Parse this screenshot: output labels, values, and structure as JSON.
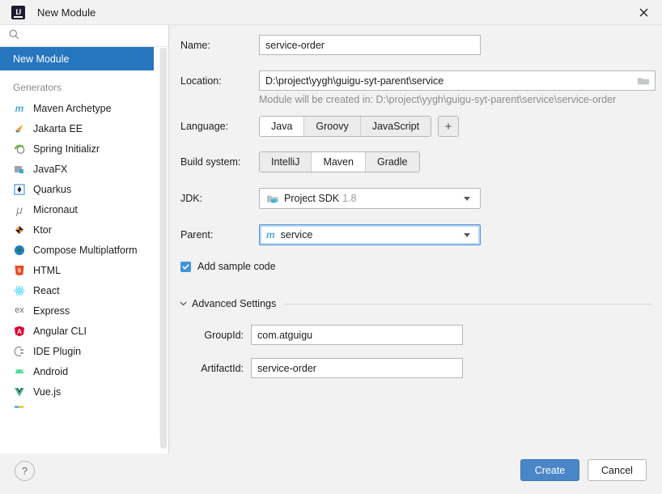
{
  "window": {
    "title": "New Module",
    "app_icon": "intellij-idea-icon",
    "close_icon": "close-icon"
  },
  "sidebar": {
    "search": {
      "value": "",
      "placeholder": "",
      "icon": "search-icon"
    },
    "selected_item": "New Module",
    "generators_label": "Generators",
    "items": [
      {
        "label": "Maven Archetype",
        "icon": "maven-icon",
        "glyph": "m",
        "color": "#4fa6dd"
      },
      {
        "label": "Jakarta EE",
        "icon": "jakarta-ee-icon",
        "glyph": "◢",
        "color": "#f89c2c"
      },
      {
        "label": "Spring Initializr",
        "icon": "spring-icon",
        "glyph": "◉",
        "color": "#6db33f"
      },
      {
        "label": "JavaFX",
        "icon": "javafx-icon",
        "glyph": "◰",
        "color": "#8c9aa5"
      },
      {
        "label": "Quarkus",
        "icon": "quarkus-icon",
        "glyph": "✸",
        "color": "#4695eb"
      },
      {
        "label": "Micronaut",
        "icon": "micronaut-icon",
        "glyph": "μ",
        "color": "#8d8d97"
      },
      {
        "label": "Ktor",
        "icon": "ktor-icon",
        "glyph": "◆",
        "color": "#f2811d"
      },
      {
        "label": "Compose Multiplatform",
        "icon": "compose-icon",
        "glyph": "●",
        "color": "#1f7ec2"
      },
      {
        "label": "HTML",
        "icon": "html5-icon",
        "glyph": "5",
        "color": "#e44d26"
      },
      {
        "label": "React",
        "icon": "react-icon",
        "glyph": "⚛",
        "color": "#61dafb"
      },
      {
        "label": "Express",
        "icon": "express-icon",
        "glyph": "ex",
        "color": "#6d6d6d"
      },
      {
        "label": "Angular CLI",
        "icon": "angular-icon",
        "glyph": "A",
        "color": "#dd0031"
      },
      {
        "label": "IDE Plugin",
        "icon": "ide-plugin-icon",
        "glyph": "◔",
        "color": "#9aa5ad"
      },
      {
        "label": "Android",
        "icon": "android-icon",
        "glyph": "◓",
        "color": "#3ddc84"
      },
      {
        "label": "Vue.js",
        "icon": "vuejs-icon",
        "glyph": "▼",
        "color": "#41b883"
      }
    ]
  },
  "form": {
    "name": {
      "label": "Name:",
      "value": "service-order"
    },
    "location": {
      "label": "Location:",
      "value": "D:\\project\\yygh\\guigu-syt-parent\\service",
      "browse_icon": "folder-icon"
    },
    "location_hint": "Module will be created in: D:\\project\\yygh\\guigu-syt-parent\\service\\service-order",
    "language": {
      "label": "Language:",
      "options": [
        "Java",
        "Groovy",
        "JavaScript"
      ],
      "selected": "Java",
      "add_label": "+"
    },
    "build_system": {
      "label": "Build system:",
      "options": [
        "IntelliJ",
        "Maven",
        "Gradle"
      ],
      "selected": "Maven"
    },
    "jdk": {
      "label": "JDK:",
      "value": "Project SDK",
      "version": "1.8",
      "icon": "jdk-folder-icon"
    },
    "parent": {
      "label": "Parent:",
      "value": "service",
      "icon": "maven-module-icon",
      "focused": true
    },
    "add_sample_code": {
      "label": "Add sample code",
      "checked": true
    },
    "advanced": {
      "label": "Advanced Settings",
      "expanded": true,
      "group_id": {
        "label": "GroupId:",
        "value": "com.atguigu"
      },
      "artifact_id": {
        "label": "ArtifactId:",
        "value": "service-order"
      }
    }
  },
  "footer": {
    "help_label": "?",
    "create_label": "Create",
    "cancel_label": "Cancel"
  },
  "colors": {
    "accent_blue": "#2675bf",
    "button_blue": "#4a86c8",
    "focus_blue": "#4a90d9",
    "checkbox_blue": "#3f93dd",
    "panel_bg": "#f2f2f2",
    "sidebar_bg": "#ffffff",
    "hint_gray": "#8c8c8c"
  }
}
